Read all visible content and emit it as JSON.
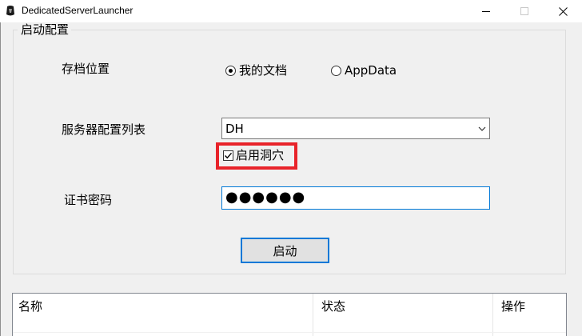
{
  "window": {
    "title": "DedicatedServerLauncher",
    "icons": {
      "app": "app-icon",
      "minimize": "minimize-icon",
      "maximize": "maximize-icon",
      "close": "close-icon"
    }
  },
  "config_group": {
    "title": "启动配置",
    "save_location_label": "存档位置",
    "save_options": [
      {
        "label": "我的文档",
        "selected": true
      },
      {
        "label": "AppData",
        "selected": false
      }
    ],
    "server_config_label": "服务器配置列表",
    "server_config_value": "DH",
    "enable_caves_label": "启用洞穴",
    "enable_caves_checked": true,
    "cert_password_label": "证书密码",
    "cert_password_value": "●●●●●●",
    "start_button": "启动",
    "highlight_color": "#e8232a",
    "focus_color": "#0078d7"
  },
  "server_list": {
    "columns": [
      "名称",
      "状态",
      "操作"
    ]
  }
}
